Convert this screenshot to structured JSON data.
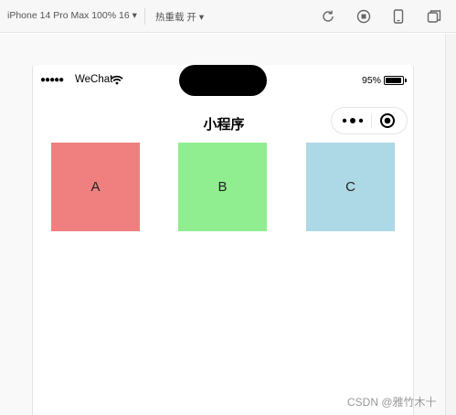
{
  "toolbar": {
    "device": "iPhone 14 Pro Max 100% 16 ▾",
    "hot_reload": "热重载 开 ▾",
    "icons": [
      "refresh-icon",
      "stop-icon",
      "phone-preview-icon",
      "window-icon"
    ]
  },
  "status_bar": {
    "signal": "●●●●●",
    "carrier": "WeChat",
    "battery": "95%",
    "battery_level": 0.95
  },
  "nav": {
    "title": "小程序",
    "capsule_icons": [
      "more-dots-icon",
      "close-circle-icon"
    ]
  },
  "boxes": [
    {
      "label": "A",
      "color": "#f08080"
    },
    {
      "label": "B",
      "color": "#90ee90"
    },
    {
      "label": "C",
      "color": "#add8e6"
    }
  ],
  "watermark": "CSDN @雅竹木十"
}
